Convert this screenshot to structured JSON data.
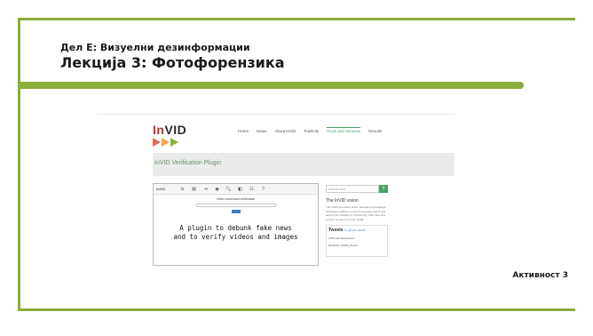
{
  "slide": {
    "subtitle": "Дел Е: Визуелни дезинформации",
    "title": "Лекција 3: Фотофорензика",
    "activity": "Активност 3",
    "accent_color": "#8aac3a"
  },
  "screenshot": {
    "logo": "InVID",
    "nav": [
      "Home",
      "News",
      "About InVID",
      "Publicity",
      "Tools and Services",
      "Results"
    ],
    "active_nav_index": 4,
    "band_title": "InVID Verification Plugin",
    "plugin": {
      "logo": "InVID",
      "icons": [
        "⊙",
        "▤",
        "⇥",
        "◉",
        "🔍",
        "◧",
        "☷",
        "?"
      ],
      "label": "Video contextual verification",
      "message_line1": "A plugin to debunk fake news",
      "message_line2": "and to verify videos and images"
    },
    "sidebar": {
      "search_placeholder": "Search here",
      "search_icon": "search-icon",
      "vision_title": "The InVID vision",
      "vision_text": "The InVID innovation action develops a knowledge verification platform to detect emerging stories and assess the reliability of newsworthy video files and content spread via social media.",
      "tweets_title": "Tweets",
      "tweets_handle": "by @invid_h2020",
      "tweet1": "InVID_EU Retweeted",
      "tweet2": "WeVerify_H2020_Project"
    }
  }
}
